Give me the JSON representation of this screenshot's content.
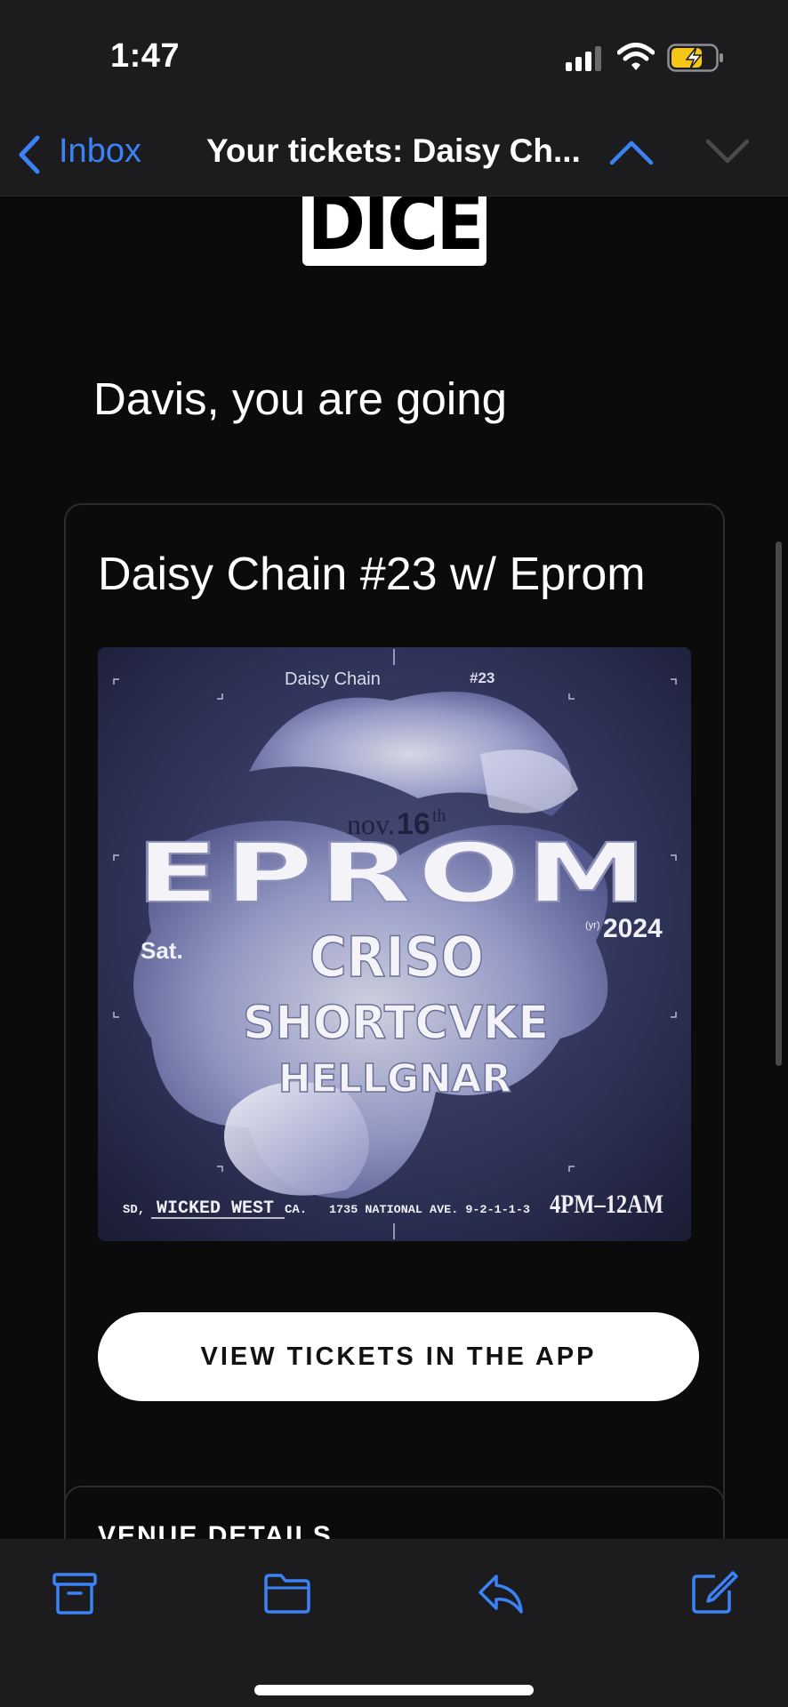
{
  "status_bar": {
    "time": "1:47"
  },
  "nav": {
    "back_label": "Inbox",
    "title": "Your tickets: Daisy Ch...",
    "accent": "#3b82f6"
  },
  "email": {
    "logo_text": "DICE",
    "greeting": "Davis, you are going",
    "event_title": "Daisy Chain #23 w/ Eprom",
    "poster": {
      "series": "Daisy Chain",
      "number": "#23",
      "date_month": "nov.",
      "date_day": "16",
      "date_suffix": "th",
      "headliner": "EPROM",
      "weekday": "Sat.",
      "year_label": "(yr)",
      "year": "2024",
      "artists": [
        "CRISO",
        "SHORTCVKE",
        "HELLGNAR"
      ],
      "footer_city": "SD,",
      "footer_venue": "WICKED WEST",
      "footer_state": "CA.",
      "footer_address": "1735 NATIONAL AVE. 9-2-1-1-3",
      "footer_time": "4PM–12AM"
    },
    "cta_label": "VIEW TICKETS IN THE APP",
    "venue_section_label": "VENUE DETAILS"
  },
  "toolbar": {
    "icons": [
      "archive-icon",
      "folder-icon",
      "reply-icon",
      "compose-icon"
    ]
  }
}
